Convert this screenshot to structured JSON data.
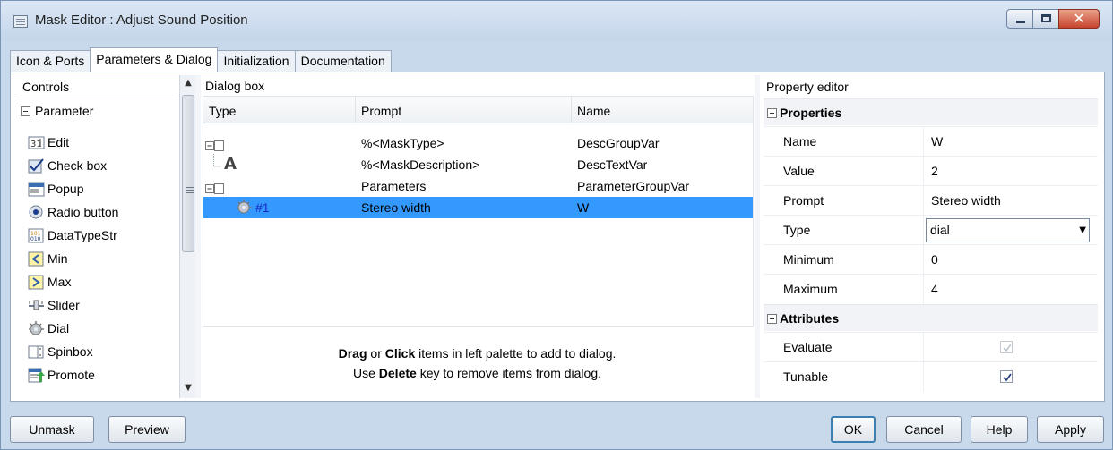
{
  "window": {
    "title": "Mask Editor : Adjust Sound Position"
  },
  "tabs": [
    "Icon & Ports",
    "Parameters & Dialog",
    "Initialization",
    "Documentation"
  ],
  "controls": {
    "header": "Controls",
    "group": "Parameter",
    "items": [
      {
        "label": "Edit",
        "icon": "edit-icon"
      },
      {
        "label": "Check box",
        "icon": "checkbox-icon"
      },
      {
        "label": "Popup",
        "icon": "popup-icon"
      },
      {
        "label": "Radio button",
        "icon": "radio-icon"
      },
      {
        "label": "DataTypeStr",
        "icon": "datatype-icon"
      },
      {
        "label": "Min",
        "icon": "min-icon"
      },
      {
        "label": "Max",
        "icon": "max-icon"
      },
      {
        "label": "Slider",
        "icon": "slider-icon"
      },
      {
        "label": "Dial",
        "icon": "dial-icon"
      },
      {
        "label": "Spinbox",
        "icon": "spinbox-icon"
      },
      {
        "label": "Promote",
        "icon": "promote-icon"
      }
    ]
  },
  "dialog_box": {
    "header": "Dialog box",
    "columns": [
      "Type",
      "Prompt",
      "Name"
    ],
    "rows": [
      {
        "type": "",
        "prompt": "%<MaskType>",
        "name": "DescGroupVar"
      },
      {
        "type": "A",
        "prompt": "%<MaskDescription>",
        "name": "DescTextVar"
      },
      {
        "type": "",
        "prompt": "Parameters",
        "name": "ParameterGroupVar"
      },
      {
        "type": "#1",
        "prompt": "Stereo width",
        "name": "W"
      }
    ],
    "hint_line1_bold1": "Drag",
    "hint_line1_mid": " or ",
    "hint_line1_bold2": "Click",
    "hint_line1_rest": " items in left palette to add to dialog.",
    "hint_line2_start": "Use ",
    "hint_line2_bold": "Delete",
    "hint_line2_rest": " key to remove items from dialog."
  },
  "property_editor": {
    "header": "Property editor",
    "properties_section": "Properties",
    "properties": [
      {
        "name": "Name",
        "value": "W"
      },
      {
        "name": "Value",
        "value": "2"
      },
      {
        "name": "Prompt",
        "value": "Stereo width"
      },
      {
        "name": "Type",
        "value": "dial"
      },
      {
        "name": "Minimum",
        "value": "0"
      },
      {
        "name": "Maximum",
        "value": "4"
      }
    ],
    "attributes_section": "Attributes",
    "attributes": [
      {
        "name": "Evaluate",
        "checked": true,
        "enabled": false
      },
      {
        "name": "Tunable",
        "checked": true,
        "enabled": true
      }
    ]
  },
  "buttons": {
    "unmask": "Unmask",
    "preview": "Preview",
    "ok": "OK",
    "cancel": "Cancel",
    "help": "Help",
    "apply": "Apply"
  },
  "colors": {
    "selection": "#3399ff",
    "window_frame": "#c9d9ec"
  }
}
